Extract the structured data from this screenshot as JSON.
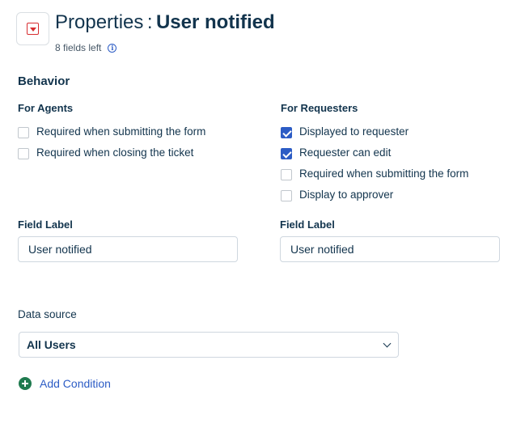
{
  "header": {
    "icon": "dropdown-field-icon",
    "title_prefix": "Properties",
    "title_separator": ":",
    "title_name": "User notified",
    "fields_left": "8 fields left",
    "info_icon": "info-icon"
  },
  "behavior": {
    "title": "Behavior",
    "agents": {
      "heading": "For Agents",
      "options": [
        {
          "label": "Required when submitting the form",
          "checked": false
        },
        {
          "label": "Required when closing the ticket",
          "checked": false
        }
      ]
    },
    "requesters": {
      "heading": "For Requesters",
      "options": [
        {
          "label": "Displayed to requester",
          "checked": true
        },
        {
          "label": "Requester can edit",
          "checked": true
        },
        {
          "label": "Required when submitting the form",
          "checked": false
        },
        {
          "label": "Display to approver",
          "checked": false
        }
      ]
    }
  },
  "field_labels": {
    "agent": {
      "label": "Field Label",
      "value": "User notified"
    },
    "requester": {
      "label": "Field Label",
      "value": "User notified"
    }
  },
  "data_source": {
    "label": "Data source",
    "selected": "All Users"
  },
  "add_condition": {
    "label": "Add Condition"
  },
  "colors": {
    "accent": "#2c5cc5",
    "field_icon": "#d72d30",
    "add_icon": "#1f7a4f",
    "text": "#12344d"
  }
}
